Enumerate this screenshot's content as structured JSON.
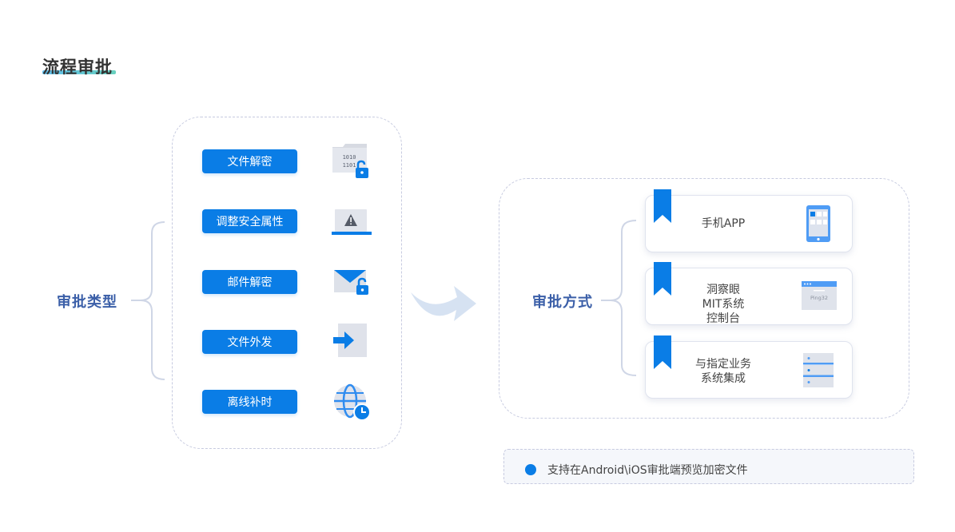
{
  "page": {
    "title": "流程审批"
  },
  "left": {
    "label": "审批类型",
    "items": [
      {
        "label": "文件解密",
        "icon": "encrypted-file-unlock-icon"
      },
      {
        "label": "调整安全属性",
        "icon": "laptop-warning-icon"
      },
      {
        "label": "邮件解密",
        "icon": "mail-unlock-icon"
      },
      {
        "label": "文件外发",
        "icon": "file-send-arrow-icon"
      },
      {
        "label": "离线补时",
        "icon": "globe-clock-icon"
      }
    ]
  },
  "right": {
    "label": "审批方式",
    "methods": [
      {
        "lines": [
          "手机APP"
        ],
        "icon": "mobile-phone-icon"
      },
      {
        "lines": [
          "洞察眼",
          "MIT系统",
          "控制台"
        ],
        "icon": "browser-window-icon",
        "icon_text": "Ping32"
      },
      {
        "lines": [
          "与指定业务",
          "系统集成"
        ],
        "icon": "server-stack-icon"
      }
    ]
  },
  "note": {
    "text": "支持在Android\\iOS审批端预览加密文件"
  },
  "colors": {
    "primary": "#0a7de6",
    "label": "#3b5fa8",
    "bracket": "#cfd6e6",
    "arrow": "#d6e2f2"
  }
}
